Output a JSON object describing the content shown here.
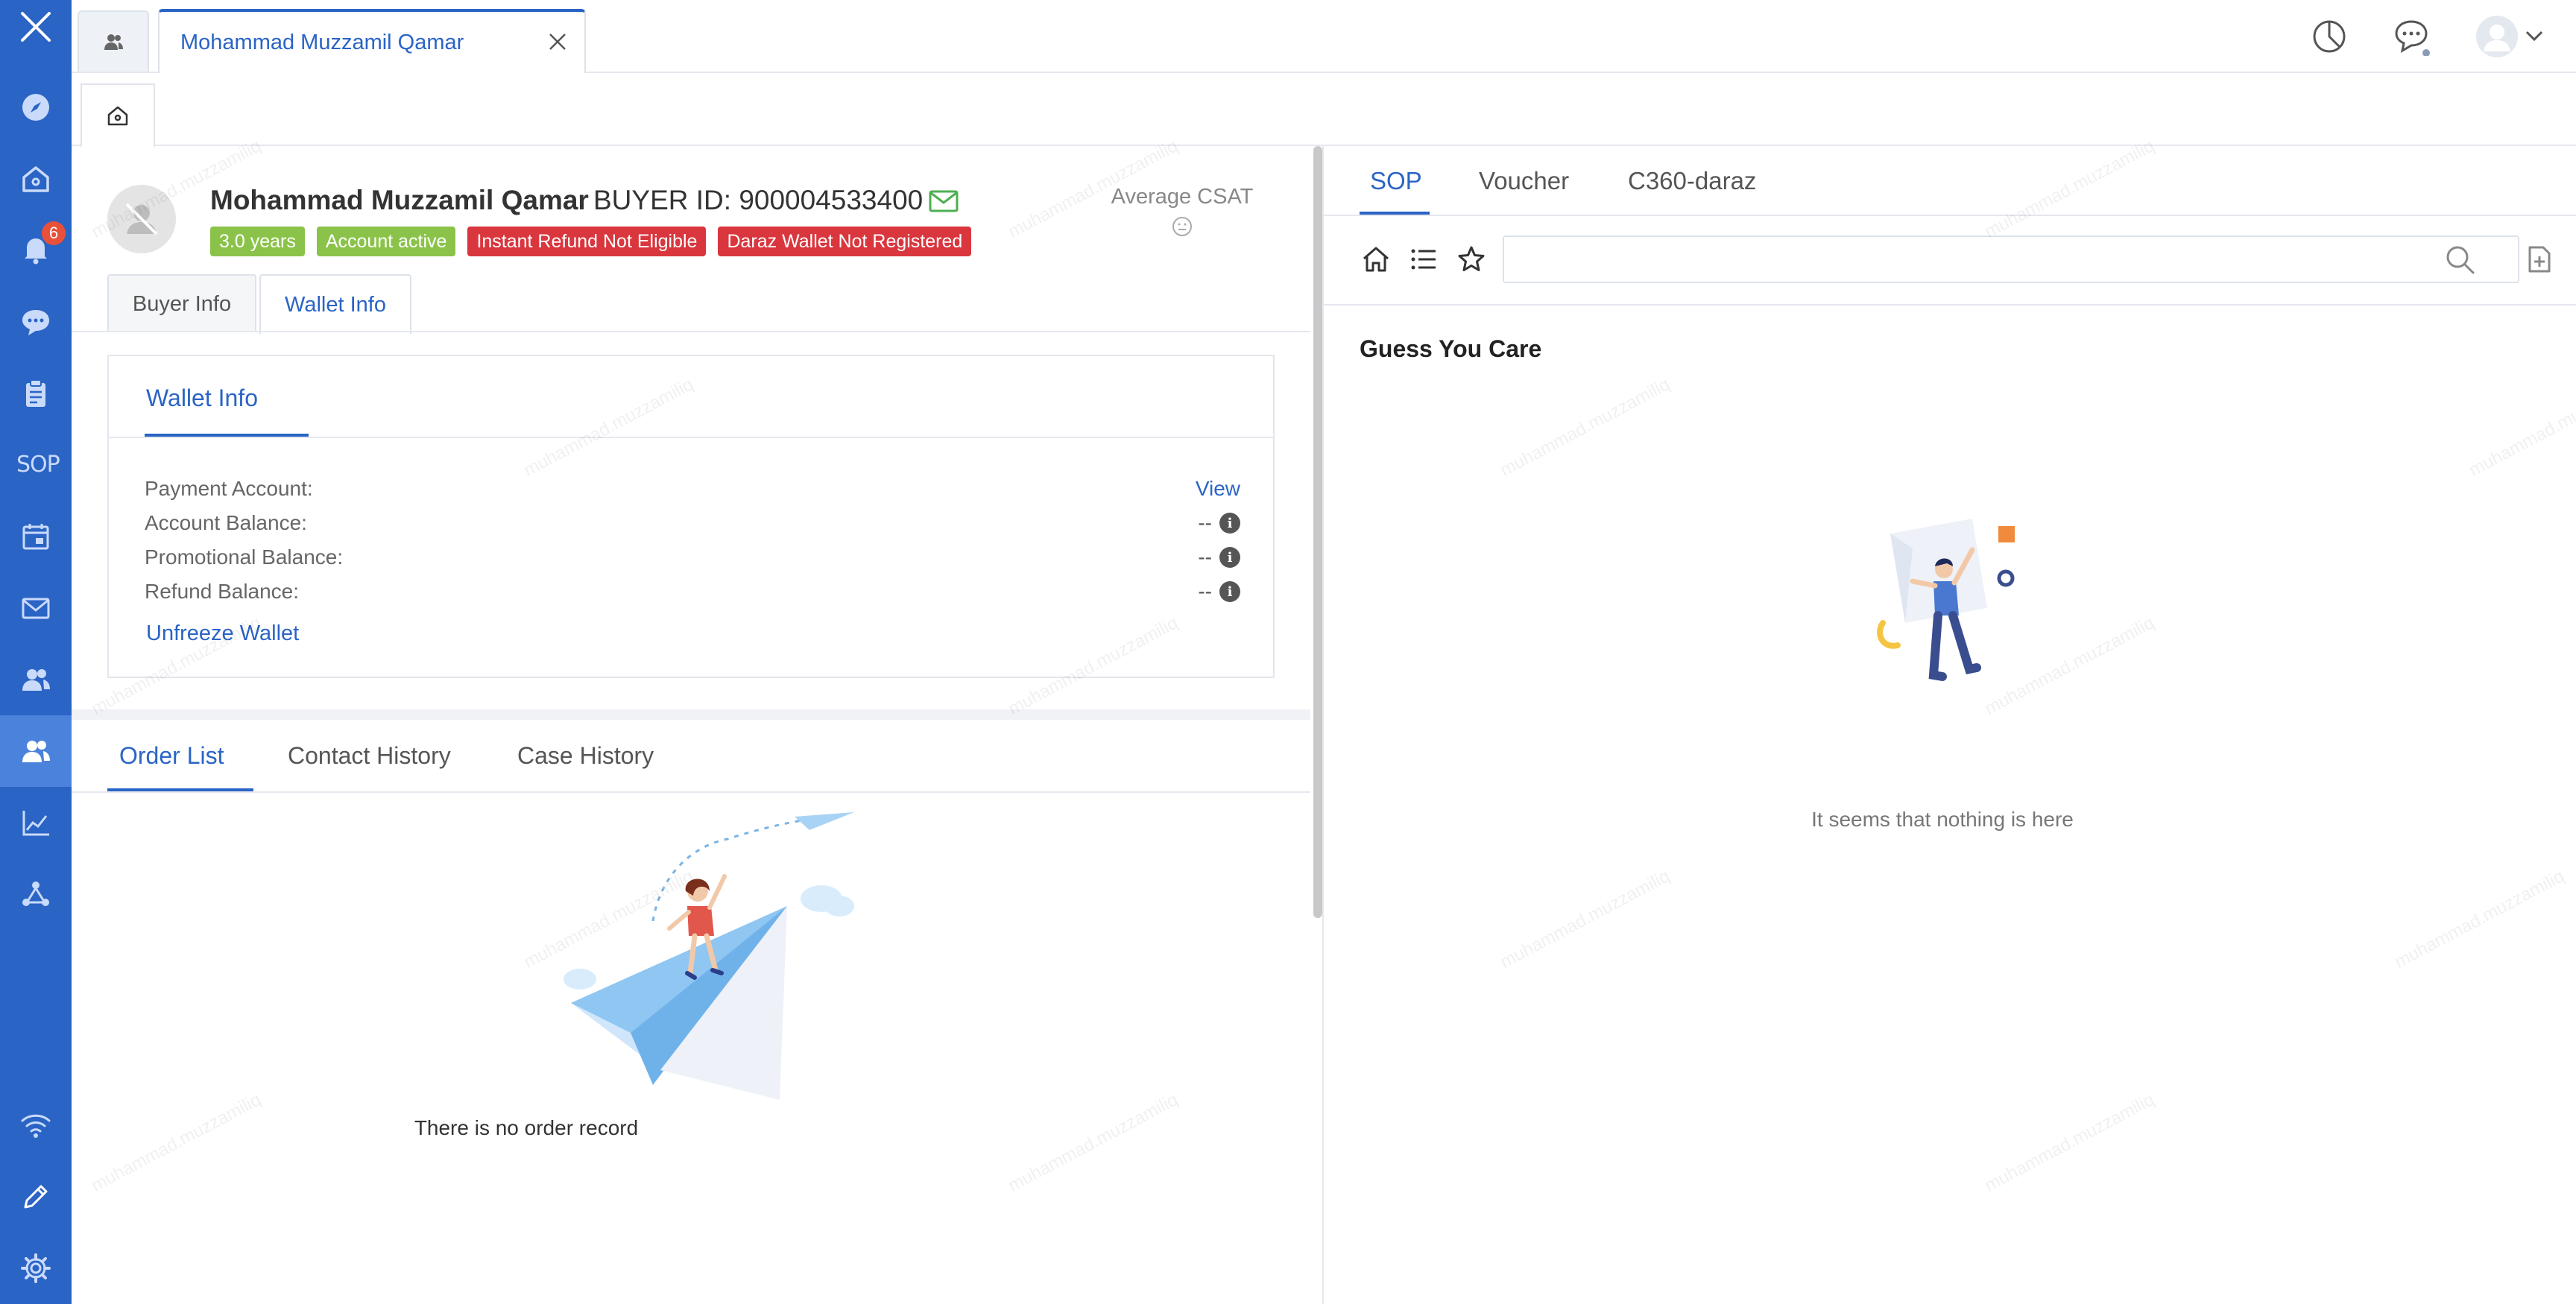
{
  "window": {
    "tab_title": "Mohammad Muzzamil Qamar"
  },
  "sidebar": {
    "notification_count": "6",
    "sop_label": "SOP"
  },
  "customer": {
    "name": "Mohammad Muzzamil Qamar",
    "buyer_id": "BUYER ID: 900004533400",
    "tags": [
      "3.0 years",
      "Account active",
      "Instant Refund Not Eligible",
      "Daraz Wallet Not Registered"
    ],
    "csat_label": "Average CSAT"
  },
  "info_tabs": {
    "buyer_info": "Buyer Info",
    "wallet_info": "Wallet Info"
  },
  "wallet": {
    "title": "Wallet Info",
    "payment_account_label": "Payment Account:",
    "payment_account_value": "View",
    "account_balance_label": "Account Balance:",
    "account_balance_value": "--",
    "promotional_balance_label": "Promotional Balance:",
    "promotional_balance_value": "--",
    "refund_balance_label": "Refund Balance:",
    "refund_balance_value": "--",
    "unfreeze_label": "Unfreeze Wallet"
  },
  "order_tabs": {
    "order_list": "Order List",
    "contact_history": "Contact History",
    "case_history": "Case History",
    "empty_text": "There is no order record"
  },
  "right": {
    "tabs": [
      "SOP",
      "Voucher",
      "C360-daraz"
    ],
    "search_value": "",
    "guess_title": "Guess You Care",
    "empty_text": "It seems that nothing is here"
  },
  "watermark_text": "muhammad.muzzamiliq",
  "colors": {
    "brand_blue": "#2a64c5",
    "tag_green": "#8bc34a",
    "tag_red": "#d9363e"
  }
}
